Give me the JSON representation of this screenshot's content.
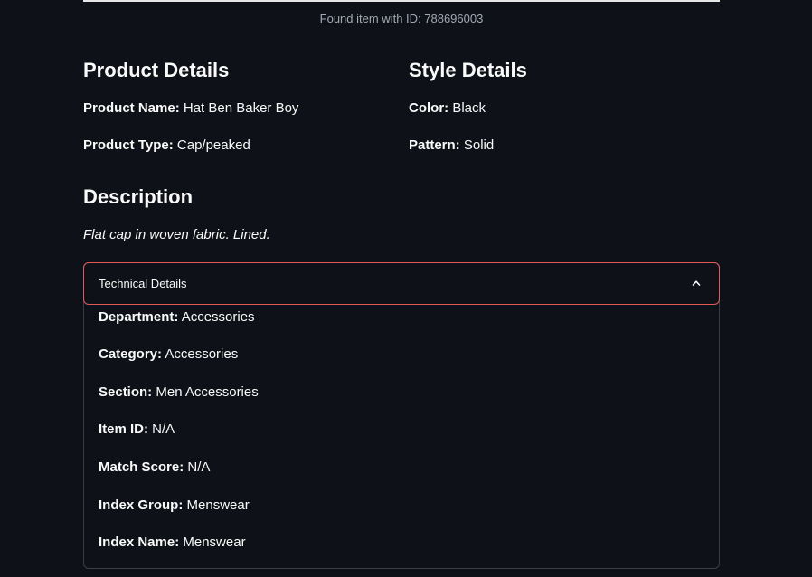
{
  "caption": "Found item with ID: 788696003",
  "product_details": {
    "heading": "Product Details",
    "name_label": "Product Name:",
    "name_value": " Hat Ben Baker Boy",
    "type_label": "Product Type:",
    "type_value": " Cap/peaked"
  },
  "style_details": {
    "heading": "Style Details",
    "color_label": "Color:",
    "color_value": " Black",
    "pattern_label": "Pattern:",
    "pattern_value": " Solid"
  },
  "description": {
    "heading": "Description",
    "text": "Flat cap in woven fabric. Lined."
  },
  "technical_details": {
    "title": "Technical Details",
    "chevron_icon": "chevron-up-icon",
    "fields": [
      {
        "label": "Department:",
        "value": " Accessories"
      },
      {
        "label": "Category:",
        "value": " Accessories"
      },
      {
        "label": "Section:",
        "value": " Men Accessories"
      },
      {
        "label": "Item ID:",
        "value": " N/A"
      },
      {
        "label": "Match Score:",
        "value": " N/A"
      },
      {
        "label": "Index Group:",
        "value": " Menswear"
      },
      {
        "label": "Index Name:",
        "value": " Menswear"
      }
    ]
  },
  "colors": {
    "background": "#0e1117",
    "text": "#fafafa",
    "muted": "#a3a8b4",
    "focus_border": "#e05a5a",
    "border": "#3a3d46"
  }
}
